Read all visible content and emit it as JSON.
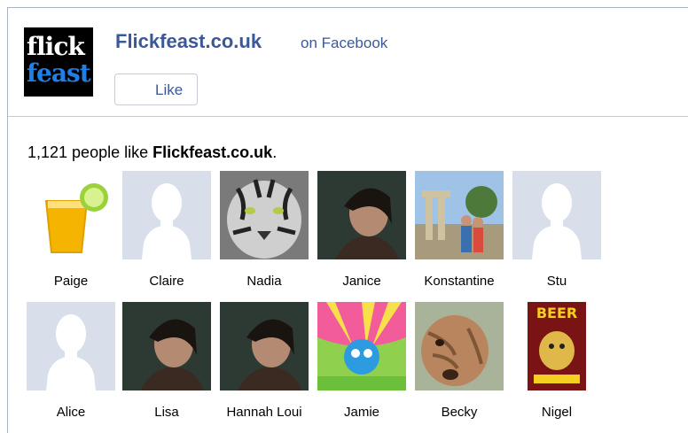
{
  "header": {
    "logo_line1": "flick",
    "logo_line2": "feast",
    "page_name": "Flickfeast.co.uk",
    "on_facebook": "on Facebook",
    "like_label": "Like"
  },
  "summary": {
    "count_text": "1,121 people like",
    "page_name": "Flickfeast.co.uk",
    "period": "."
  },
  "fans": [
    {
      "name": "Paige",
      "picture": "orange-juice-icon"
    },
    {
      "name": "Claire",
      "picture": "default-silhouette"
    },
    {
      "name": "Nadia",
      "picture": "tiger-photo"
    },
    {
      "name": "Janice",
      "picture": "portrait-photo"
    },
    {
      "name": "Konstantine",
      "picture": "ruins-photo"
    },
    {
      "name": "Stu",
      "picture": "default-silhouette"
    },
    {
      "name": "Alice",
      "picture": "default-silhouette"
    },
    {
      "name": "Lisa",
      "picture": "portrait-photo"
    },
    {
      "name": "Hannah Loui",
      "picture": "portrait-photo"
    },
    {
      "name": "Jamie",
      "picture": "cartoon-photo"
    },
    {
      "name": "Becky",
      "picture": "dog-photo"
    },
    {
      "name": "Nigel",
      "picture": "beer-poster"
    }
  ],
  "colors": {
    "brand_blue": "#3b5998",
    "silhouette_bg": "#d8dfea",
    "logo_blue": "#1f7fe8"
  }
}
